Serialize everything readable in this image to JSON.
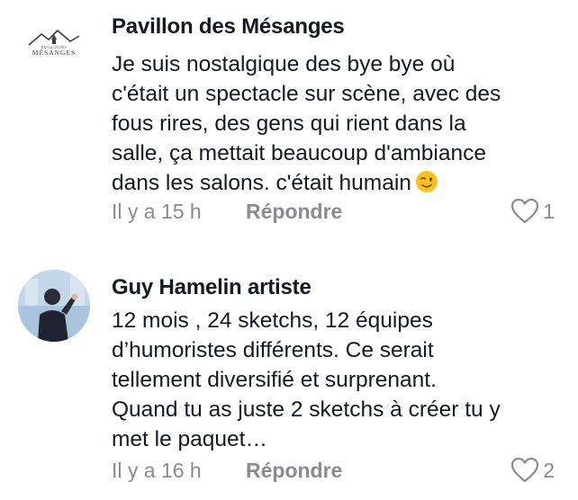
{
  "comments": [
    {
      "author": "Pavillon des Mésanges",
      "avatar_logo_text": "MÉSANGES",
      "avatar_logo_subtext": "PAVILLON DES",
      "lines": [
        "Je suis nostalgique des bye bye où",
        "c'était un spectacle sur scène, avec des",
        "fous rires, des gens qui rient dans la",
        "salle, ça mettait beaucoup d'ambiance",
        "dans les salons. c'était humain"
      ],
      "trailing_emoji": "winking-face-emoji",
      "time": "Il y a 15 h",
      "reply_label": "Répondre",
      "like_count": "1"
    },
    {
      "author": "Guy Hamelin artiste",
      "lines": [
        "12 mois , 24 sketchs, 12 équipes",
        "d’humoristes différents. Ce serait",
        "tellement diversifié et surprenant.",
        "Quand tu as juste 2 sketchs à créer tu y",
        "met le paquet…"
      ],
      "time": "Il y a 16 h",
      "reply_label": "Répondre",
      "like_count": "2"
    }
  ],
  "colors": {
    "text": "#161823",
    "muted": "#8a8b91",
    "background": "#ffffff"
  }
}
